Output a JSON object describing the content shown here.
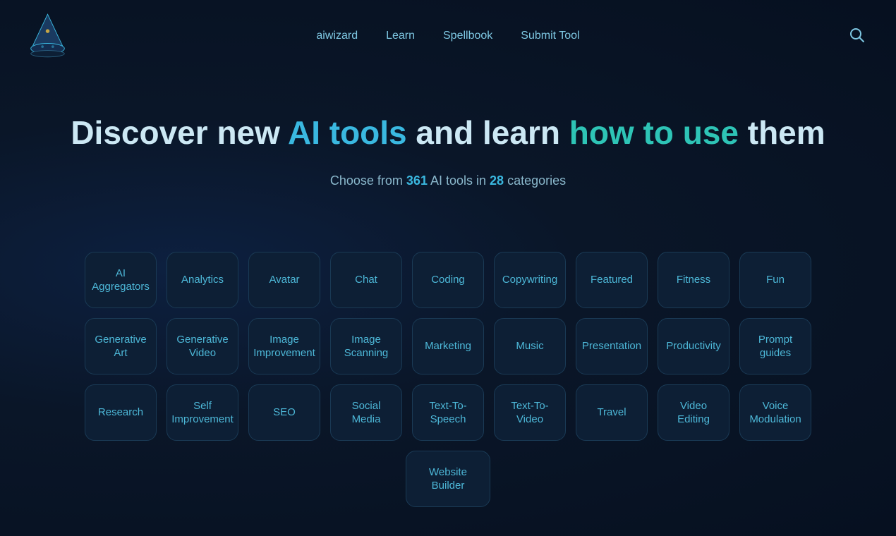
{
  "nav": {
    "brand": "aiwizard",
    "links": [
      "aiwizard",
      "Learn",
      "Spellbook",
      "Submit Tool"
    ]
  },
  "hero": {
    "heading_part1": "Discover new ",
    "heading_accent1": "AI tools",
    "heading_part2": " and learn ",
    "heading_accent2": "how to use",
    "heading_part3": " them",
    "subtitle_prefix": "Choose from ",
    "tool_count": "361",
    "subtitle_mid": " AI tools in ",
    "category_count": "28",
    "subtitle_suffix": " categories"
  },
  "categories": {
    "row1": [
      "AI Aggregators",
      "Analytics",
      "Avatar",
      "Chat",
      "Coding",
      "Copywriting",
      "Featured",
      "Fitness",
      "Fun"
    ],
    "row2": [
      "Generative Art",
      "Generative Video",
      "Image Improvement",
      "Image Scanning",
      "Marketing",
      "Music",
      "Presentation",
      "Productivity",
      "Prompt guides"
    ],
    "row3": [
      "Research",
      "Self Improvement",
      "SEO",
      "Social Media",
      "Text-To-Speech",
      "Text-To-Video",
      "Travel",
      "Video Editing",
      "Voice Modulation"
    ],
    "row4": [
      "Website Builder"
    ]
  }
}
